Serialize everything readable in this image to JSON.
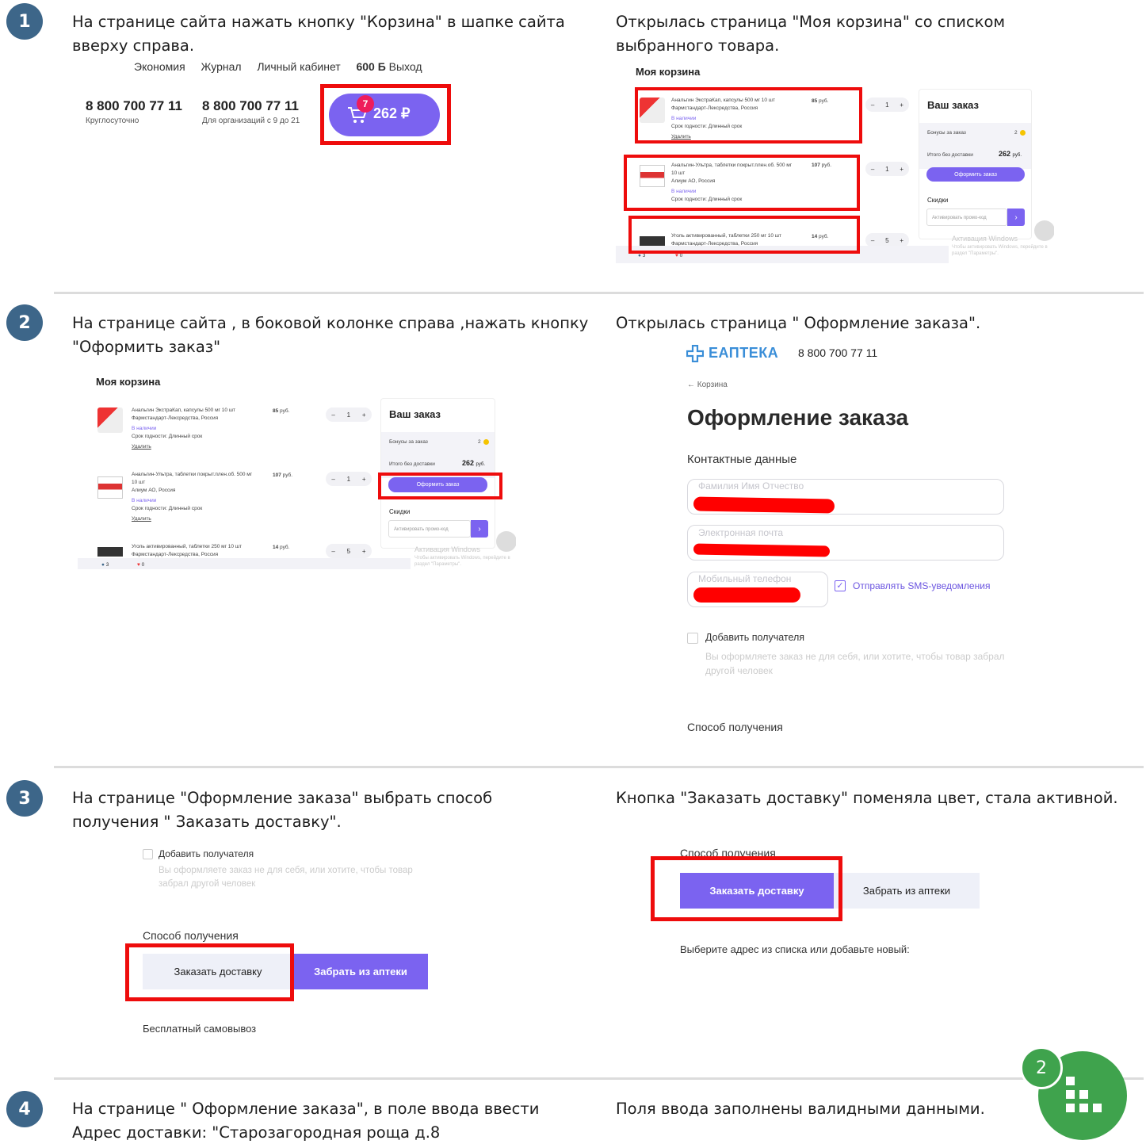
{
  "steps": [
    {
      "number": "1",
      "action": "На странице сайта нажать кнопку \"Корзина\" в шапке сайта вверху справа.",
      "result": "Открылась страница \"Моя корзина\" со списком выбранного товара."
    },
    {
      "number": "2",
      "action": "На странице сайта , в боковой колонке справа ,нажать кнопку \"Оформить заказ\"",
      "result": "Открылась страница \" Оформление заказа\"."
    },
    {
      "number": "3",
      "action": "На странице \"Оформление заказа\" выбрать способ получения \" Заказать доставку\".",
      "result": "Кнопка \"Заказать доставку\" поменяла цвет, стала активной."
    },
    {
      "number": "4",
      "action": "На странице \" Оформление заказа\", в поле ввода ввести Адрес доставки:  \"Старозагородная роща д.8",
      "result": "Поля ввода заполнены валидными данными."
    }
  ],
  "header_shot": {
    "nav": [
      "Экономия",
      "Журнал",
      "Личный кабинет"
    ],
    "balance": "600 Б",
    "logout": "Выход",
    "phone1": "8 800 700 77 11",
    "phone1_note": "Круглосуточно",
    "phone2": "8 800 700 77 11",
    "phone2_note": "Для организаций с 9 до 21",
    "cart_count": "7",
    "cart_total": "262 ₽"
  },
  "cart": {
    "title": "Моя корзина",
    "items": [
      {
        "name": "Анальгин ЭкстраКап, капсулы 500 мг 10 шт",
        "maker": "Фармстандарт-Лексредства, Россия",
        "stock": "В наличии",
        "expiry": "Срок годности: Длинный срок",
        "remove": "Удалить",
        "price": "85",
        "currency": "руб.",
        "qty": "1"
      },
      {
        "name": "Анальгин-Ультра, таблетки покрыт.плен.об. 500 мг",
        "name2": "10 шт",
        "maker": "Алиум АО, Россия",
        "stock": "В наличии",
        "expiry": "Срок годности: Длинный срок",
        "remove": "Удалить",
        "price": "107",
        "currency": "руб.",
        "qty": "1"
      },
      {
        "name": "Уголь активированный, таблетки 250 мг 10 шт",
        "maker": "Фармстандарт-Лексредства, Россия",
        "price": "14",
        "currency": "руб.",
        "qty": "5"
      }
    ],
    "summary": {
      "title": "Ваш заказ",
      "bonus_label": "Бонусы за заказ",
      "bonus_value": "2",
      "total_label": "Итого без доставки",
      "total_value": "262",
      "total_currency": "руб.",
      "checkout": "Оформить заказ",
      "discounts": "Скидки",
      "promo_placeholder": "Активировать промо-код"
    },
    "windows_watermark": "Активация Windows",
    "windows_hint": "Чтобы активировать Windows, перейдите в раздел \"Параметры\".",
    "views": "3",
    "likes": "0"
  },
  "checkout_shot": {
    "logo": "ЕАПТЕКА",
    "phone": "8 800 700 77 11",
    "back": "← Корзина",
    "title": "Оформление заказа",
    "contacts": "Контактные данные",
    "fio_placeholder": "Фамилия Имя Отчество",
    "email_placeholder": "Электронная почта",
    "phone_placeholder": "Мобильный телефон",
    "sms": "Отправлять SMS-уведомления",
    "add_recipient": "Добавить получателя",
    "recipient_hint": "Вы оформляете заказ не для себя, или хотите, чтобы товар забрал другой человек",
    "delivery_method": "Способ получения"
  },
  "delivery_shot": {
    "add_recipient": "Добавить получателя",
    "recipient_hint": "Вы оформляете заказ не для себя, или хотите, чтобы товар забрал другой человек",
    "method": "Способ получения",
    "order_delivery": "Заказать доставку",
    "pickup": "Забрать из аптеки",
    "free_pickup": "Бесплатный самовывоз"
  },
  "delivery_result": {
    "method": "Способ получения",
    "order_delivery": "Заказать доставку",
    "pickup": "Забрать из аптеки",
    "choose_address": "Выберите адрес из списка или добавьте новый:"
  },
  "fab": {
    "count": "2"
  },
  "colors": {
    "badge": "#3d6689",
    "accent": "#7b63f0",
    "highlight": "#ee0c0c",
    "fab": "#3fa34d"
  }
}
